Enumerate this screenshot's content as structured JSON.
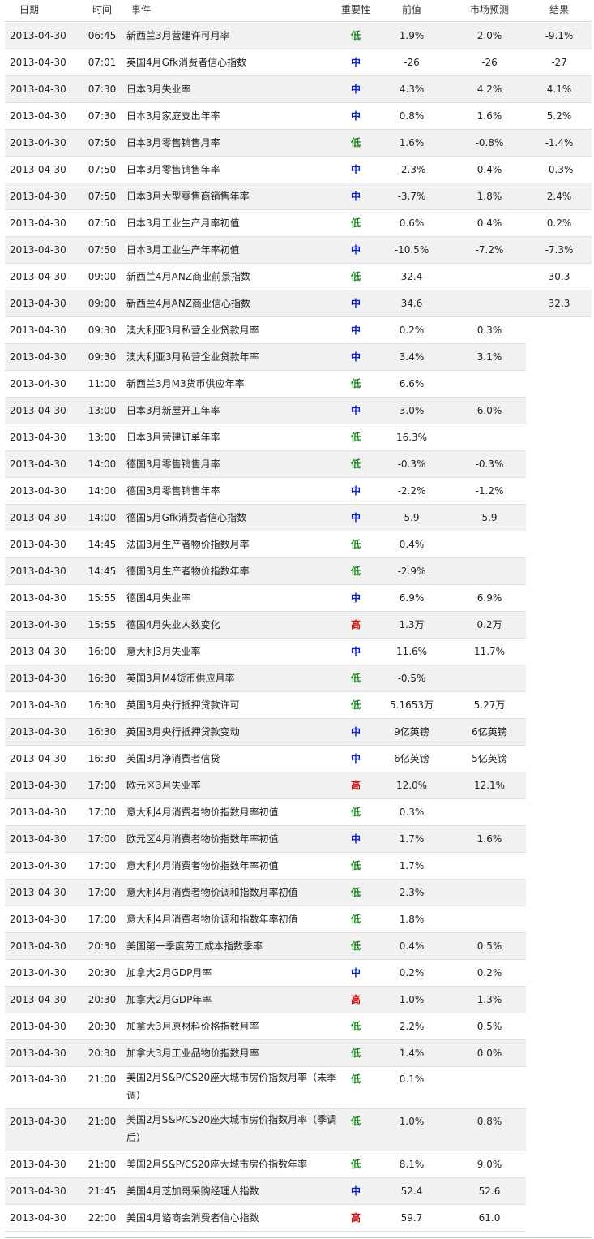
{
  "headers": {
    "date": "日期",
    "time": "时间",
    "event": "事件",
    "importance": "重要性",
    "previous": "前值",
    "forecast": "市场预测",
    "actual": "结果"
  },
  "importance_colors": {
    "低": "#19801e",
    "中": "#0b22b8",
    "高": "#cc1111"
  },
  "rows": [
    {
      "date": "2013-04-30",
      "time": "06:45",
      "event": "新西兰3月营建许可月率",
      "importance": "低",
      "previous": "1.9%",
      "forecast": "2.0%",
      "actual": "-9.1%"
    },
    {
      "date": "2013-04-30",
      "time": "07:01",
      "event": "英国4月Gfk消费者信心指数",
      "importance": "中",
      "previous": "-26",
      "forecast": "-26",
      "actual": "-27"
    },
    {
      "date": "2013-04-30",
      "time": "07:30",
      "event": "日本3月失业率",
      "importance": "中",
      "previous": "4.3%",
      "forecast": "4.2%",
      "actual": "4.1%"
    },
    {
      "date": "2013-04-30",
      "time": "07:30",
      "event": "日本3月家庭支出年率",
      "importance": "中",
      "previous": "0.8%",
      "forecast": "1.6%",
      "actual": "5.2%"
    },
    {
      "date": "2013-04-30",
      "time": "07:50",
      "event": "日本3月零售销售月率",
      "importance": "低",
      "previous": "1.6%",
      "forecast": "-0.8%",
      "actual": "-1.4%"
    },
    {
      "date": "2013-04-30",
      "time": "07:50",
      "event": "日本3月零售销售年率",
      "importance": "中",
      "previous": "-2.3%",
      "forecast": "0.4%",
      "actual": "-0.3%"
    },
    {
      "date": "2013-04-30",
      "time": "07:50",
      "event": "日本3月大型零售商销售年率",
      "importance": "中",
      "previous": "-3.7%",
      "forecast": "1.8%",
      "actual": "2.4%"
    },
    {
      "date": "2013-04-30",
      "time": "07:50",
      "event": "日本3月工业生产月率初值",
      "importance": "低",
      "previous": "0.6%",
      "forecast": "0.4%",
      "actual": "0.2%"
    },
    {
      "date": "2013-04-30",
      "time": "07:50",
      "event": "日本3月工业生产年率初值",
      "importance": "中",
      "previous": "-10.5%",
      "forecast": "-7.2%",
      "actual": "-7.3%"
    },
    {
      "date": "2013-04-30",
      "time": "09:00",
      "event": "新西兰4月ANZ商业前景指数",
      "importance": "低",
      "previous": "32.4",
      "forecast": "",
      "actual": "30.3"
    },
    {
      "date": "2013-04-30",
      "time": "09:00",
      "event": "新西兰4月ANZ商业信心指数",
      "importance": "中",
      "previous": "34.6",
      "forecast": "",
      "actual": "32.3"
    },
    {
      "date": "2013-04-30",
      "time": "09:30",
      "event": "澳大利亚3月私营企业贷款月率",
      "importance": "中",
      "previous": "0.2%",
      "forecast": "0.3%",
      "actual": ""
    },
    {
      "date": "2013-04-30",
      "time": "09:30",
      "event": "澳大利亚3月私营企业贷款年率",
      "importance": "中",
      "previous": "3.4%",
      "forecast": "3.1%",
      "actual": ""
    },
    {
      "date": "2013-04-30",
      "time": "11:00",
      "event": "新西兰3月M3货币供应年率",
      "importance": "低",
      "previous": "6.6%",
      "forecast": "",
      "actual": ""
    },
    {
      "date": "2013-04-30",
      "time": "13:00",
      "event": "日本3月新屋开工年率",
      "importance": "中",
      "previous": "3.0%",
      "forecast": "6.0%",
      "actual": ""
    },
    {
      "date": "2013-04-30",
      "time": "13:00",
      "event": "日本3月营建订单年率",
      "importance": "低",
      "previous": "16.3%",
      "forecast": "",
      "actual": ""
    },
    {
      "date": "2013-04-30",
      "time": "14:00",
      "event": "德国3月零售销售月率",
      "importance": "低",
      "previous": "-0.3%",
      "forecast": "-0.3%",
      "actual": ""
    },
    {
      "date": "2013-04-30",
      "time": "14:00",
      "event": "德国3月零售销售年率",
      "importance": "中",
      "previous": "-2.2%",
      "forecast": "-1.2%",
      "actual": ""
    },
    {
      "date": "2013-04-30",
      "time": "14:00",
      "event": "德国5月Gfk消费者信心指数",
      "importance": "中",
      "previous": "5.9",
      "forecast": "5.9",
      "actual": ""
    },
    {
      "date": "2013-04-30",
      "time": "14:45",
      "event": "法国3月生产者物价指数月率",
      "importance": "低",
      "previous": "0.4%",
      "forecast": "",
      "actual": ""
    },
    {
      "date": "2013-04-30",
      "time": "14:45",
      "event": "德国3月生产者物价指数年率",
      "importance": "低",
      "previous": "-2.9%",
      "forecast": "",
      "actual": ""
    },
    {
      "date": "2013-04-30",
      "time": "15:55",
      "event": "德国4月失业率",
      "importance": "中",
      "previous": "6.9%",
      "forecast": "6.9%",
      "actual": ""
    },
    {
      "date": "2013-04-30",
      "time": "15:55",
      "event": "德国4月失业人数变化",
      "importance": "高",
      "previous": "1.3万",
      "forecast": "0.2万",
      "actual": ""
    },
    {
      "date": "2013-04-30",
      "time": "16:00",
      "event": "意大利3月失业率",
      "importance": "中",
      "previous": "11.6%",
      "forecast": "11.7%",
      "actual": ""
    },
    {
      "date": "2013-04-30",
      "time": "16:30",
      "event": "英国3月M4货币供应月率",
      "importance": "低",
      "previous": "-0.5%",
      "forecast": "",
      "actual": ""
    },
    {
      "date": "2013-04-30",
      "time": "16:30",
      "event": "英国3月央行抵押贷款许可",
      "importance": "低",
      "previous": "5.1653万",
      "forecast": "5.27万",
      "actual": ""
    },
    {
      "date": "2013-04-30",
      "time": "16:30",
      "event": "英国3月央行抵押贷款变动",
      "importance": "中",
      "previous": "9亿英镑",
      "forecast": "6亿英镑",
      "actual": ""
    },
    {
      "date": "2013-04-30",
      "time": "16:30",
      "event": "英国3月净消费者信贷",
      "importance": "中",
      "previous": "6亿英镑",
      "forecast": "5亿英镑",
      "actual": ""
    },
    {
      "date": "2013-04-30",
      "time": "17:00",
      "event": "欧元区3月失业率",
      "importance": "高",
      "previous": "12.0%",
      "forecast": "12.1%",
      "actual": ""
    },
    {
      "date": "2013-04-30",
      "time": "17:00",
      "event": "意大利4月消费者物价指数月率初值",
      "importance": "低",
      "previous": "0.3%",
      "forecast": "",
      "actual": ""
    },
    {
      "date": "2013-04-30",
      "time": "17:00",
      "event": "欧元区4月消费者物价指数年率初值",
      "importance": "中",
      "previous": "1.7%",
      "forecast": "1.6%",
      "actual": ""
    },
    {
      "date": "2013-04-30",
      "time": "17:00",
      "event": "意大利4月消费者物价指数年率初值",
      "importance": "低",
      "previous": "1.7%",
      "forecast": "",
      "actual": ""
    },
    {
      "date": "2013-04-30",
      "time": "17:00",
      "event": "意大利4月消费者物价调和指数月率初值",
      "importance": "低",
      "previous": "2.3%",
      "forecast": "",
      "actual": ""
    },
    {
      "date": "2013-04-30",
      "time": "17:00",
      "event": "意大利4月消费者物价调和指数年率初值",
      "importance": "低",
      "previous": "1.8%",
      "forecast": "",
      "actual": ""
    },
    {
      "date": "2013-04-30",
      "time": "20:30",
      "event": "美国第一季度劳工成本指数季率",
      "importance": "低",
      "previous": "0.4%",
      "forecast": "0.5%",
      "actual": ""
    },
    {
      "date": "2013-04-30",
      "time": "20:30",
      "event": "加拿大2月GDP月率",
      "importance": "中",
      "previous": "0.2%",
      "forecast": "0.2%",
      "actual": ""
    },
    {
      "date": "2013-04-30",
      "time": "20:30",
      "event": "加拿大2月GDP年率",
      "importance": "高",
      "previous": "1.0%",
      "forecast": "1.3%",
      "actual": ""
    },
    {
      "date": "2013-04-30",
      "time": "20:30",
      "event": "加拿大3月原材料价格指数月率",
      "importance": "低",
      "previous": "2.2%",
      "forecast": "0.5%",
      "actual": ""
    },
    {
      "date": "2013-04-30",
      "time": "20:30",
      "event": "加拿大3月工业品物价指数月率",
      "importance": "低",
      "previous": "1.4%",
      "forecast": "0.0%",
      "actual": ""
    },
    {
      "date": "2013-04-30",
      "time": "21:00",
      "event": "美国2月S&P/CS20座大城市房价指数月率（未季调）",
      "importance": "低",
      "previous": "0.1%",
      "forecast": "",
      "actual": ""
    },
    {
      "date": "2013-04-30",
      "time": "21:00",
      "event": "美国2月S&P/CS20座大城市房价指数月率（季调后）",
      "importance": "低",
      "previous": "1.0%",
      "forecast": "0.8%",
      "actual": ""
    },
    {
      "date": "2013-04-30",
      "time": "21:00",
      "event": "美国2月S&P/CS20座大城市房价指数年率",
      "importance": "低",
      "previous": "8.1%",
      "forecast": "9.0%",
      "actual": ""
    },
    {
      "date": "2013-04-30",
      "time": "21:45",
      "event": "美国4月芝加哥采购经理人指数",
      "importance": "中",
      "previous": "52.4",
      "forecast": "52.6",
      "actual": ""
    },
    {
      "date": "2013-04-30",
      "time": "22:00",
      "event": "美国4月谘商会消费者信心指数",
      "importance": "高",
      "previous": "59.7",
      "forecast": "61.0",
      "actual": ""
    }
  ]
}
